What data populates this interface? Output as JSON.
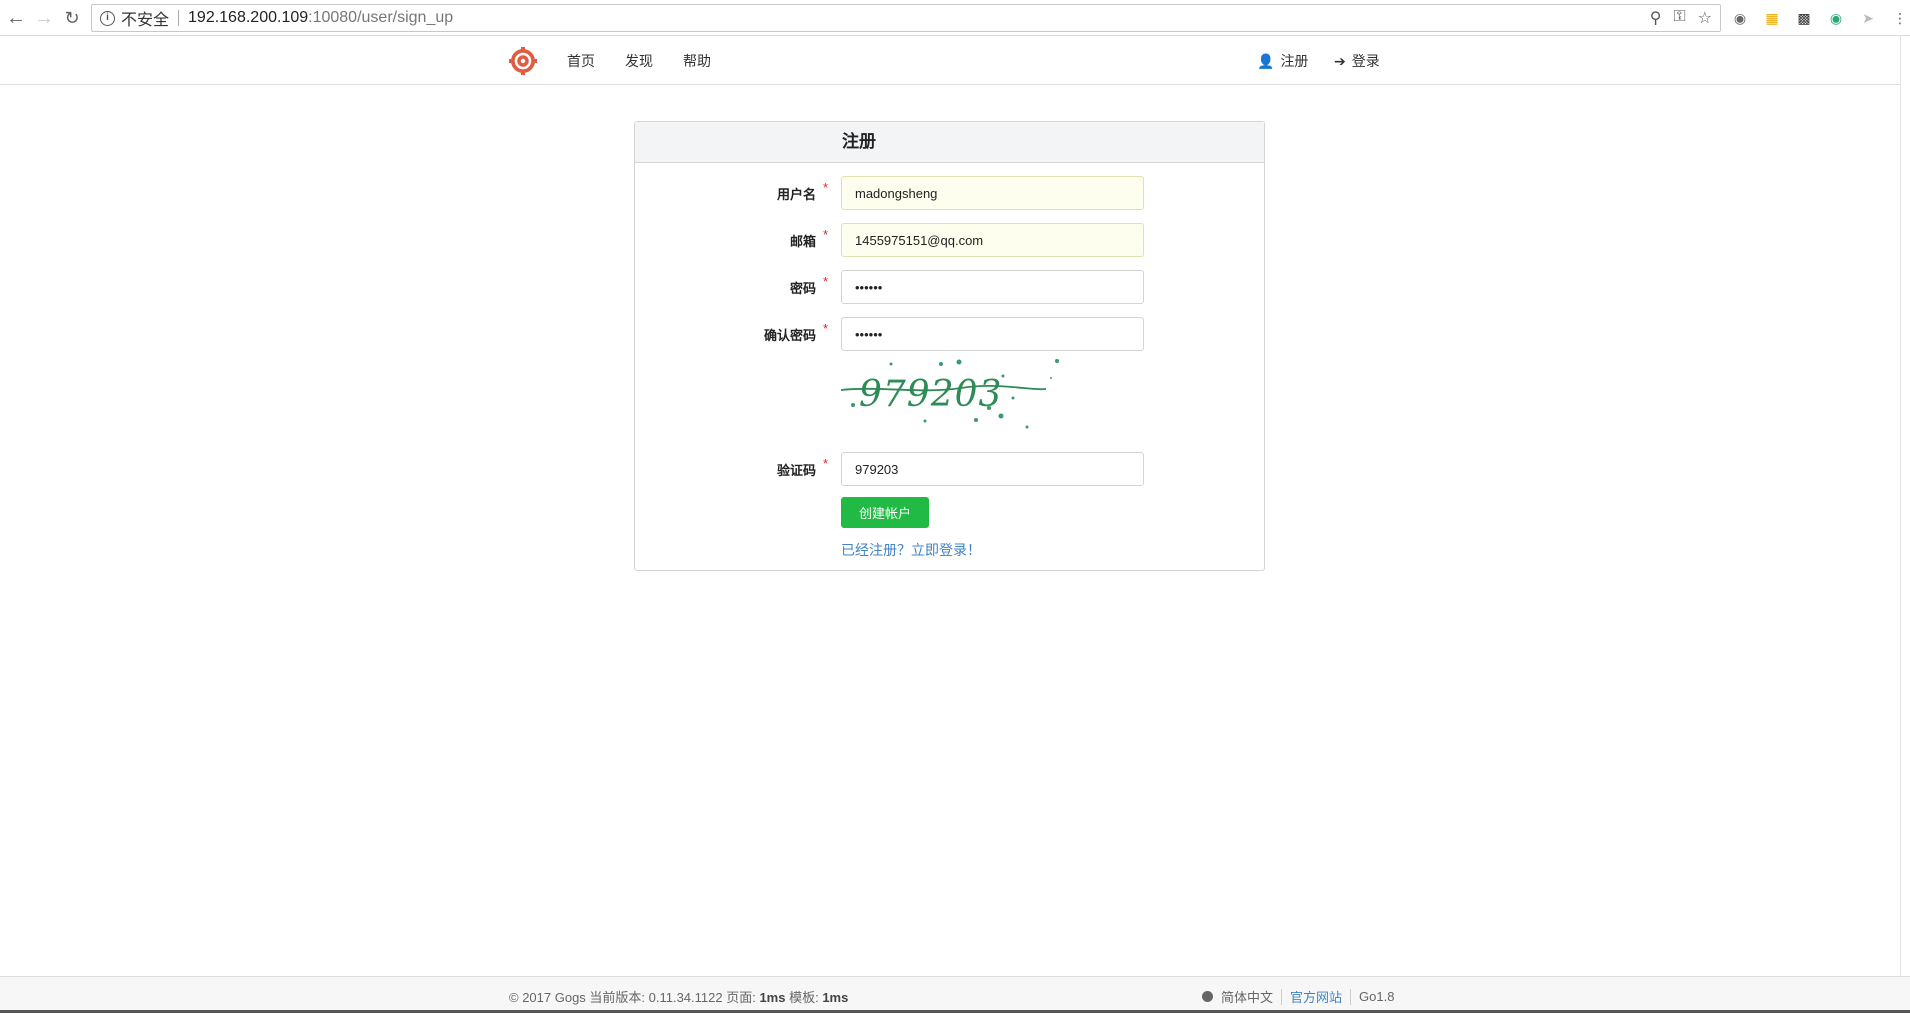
{
  "browser": {
    "insecure_label": "不安全",
    "url_host": "192.168.200.109",
    "url_rest": ":10080/user/sign_up"
  },
  "header": {
    "nav": {
      "home": "首页",
      "explore": "发现",
      "help": "帮助"
    },
    "register": "注册",
    "login": "登录"
  },
  "form": {
    "title": "注册",
    "username_label": "用户名",
    "username_value": "madongsheng",
    "email_label": "邮箱",
    "email_value": "1455975151@qq.com",
    "password_label": "密码",
    "password_value": "••••••",
    "confirm_label": "确认密码",
    "confirm_value": "••••••",
    "captcha_image_text": "979203",
    "captcha_label": "验证码",
    "captcha_value": "979203",
    "required_mark": "*",
    "submit_label": "创建帐户",
    "login_link": "已经注册？立即登录！"
  },
  "footer": {
    "copyright_prefix": "© 2017 Gogs 当前版本: 0.11.34.1122 页面: ",
    "page_time": "1ms",
    "template_label": " 模板: ",
    "template_time": "1ms",
    "language": "简体中文",
    "website": "官方网站",
    "go_version": "Go1.8"
  },
  "colors": {
    "primary_green": "#21ba45",
    "link_blue": "#4183c4",
    "required_red": "#db2828",
    "logo_red": "#e05d44"
  }
}
